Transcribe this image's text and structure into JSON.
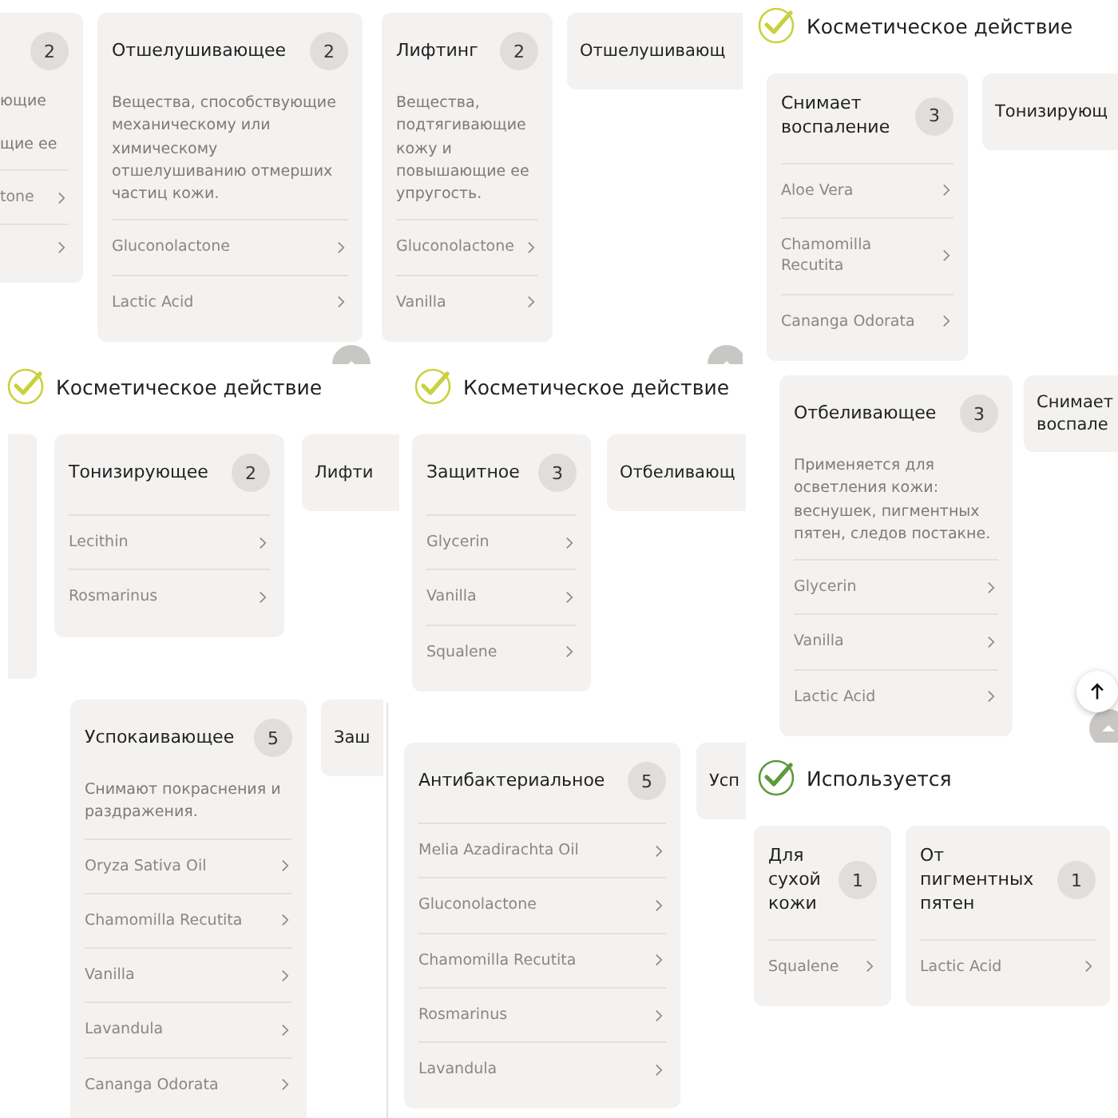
{
  "fragments": [
    {
      "cards": [
        {
          "kind": "partial-left",
          "badge": "2",
          "description_fragments": [
            "ющие",
            "щие ее"
          ],
          "items": [
            {
              "kind": "link",
              "name": "tone"
            },
            {
              "kind": "cut"
            }
          ]
        },
        {
          "kind": "full",
          "title": "Отшелушивающее",
          "badge": "2",
          "description": "Вещества, способствующие механическому или химическому отшелушиванию отмерших частиц кожи.",
          "items": [
            {
              "name": "Gluconolactone"
            },
            {
              "name": "Lactic Acid"
            }
          ]
        }
      ],
      "scroll_button": true
    },
    {
      "cards": [
        {
          "kind": "full",
          "title": "Лифтинг",
          "badge": "2",
          "description": "Вещества, подтягивающие кожу и повышающие ее упругость.",
          "items": [
            {
              "name": "Gluconolactone"
            },
            {
              "name": "Vanilla"
            }
          ]
        },
        {
          "kind": "partial-right",
          "title": "Отшелушивающ"
        }
      ],
      "scroll_button": true
    },
    {
      "heading": {
        "text": "Косметическое действие",
        "color": "#c9d13c"
      },
      "cards": [
        {
          "kind": "full",
          "title": "Снимает воспаление",
          "badge": "3",
          "items": [
            {
              "name": "Aloe Vera"
            },
            {
              "name": "Chamomilla Recutita"
            },
            {
              "name": "Cananga Odorata"
            }
          ]
        },
        {
          "kind": "partial-right",
          "title": "Тонизирующ"
        }
      ]
    },
    {
      "heading": {
        "text": "Косметическое действие",
        "color": "#c9d13c"
      },
      "cards": [
        {
          "kind": "edge"
        },
        {
          "kind": "full",
          "title": "Тонизирующее",
          "badge": "2",
          "items": [
            {
              "name": "Lecithin"
            },
            {
              "name": "Rosmarinus"
            }
          ]
        },
        {
          "kind": "partial-right",
          "title": "Лифти"
        }
      ]
    },
    {
      "heading": {
        "text": "Косметическое действие",
        "color": "#c9d13c"
      },
      "cards": [
        {
          "kind": "full",
          "title": "Защитное",
          "badge": "3",
          "items": [
            {
              "name": "Glycerin"
            },
            {
              "name": "Vanilla"
            },
            {
              "name": "Squalene"
            }
          ]
        },
        {
          "kind": "partial-right",
          "title": "Отбеливающ"
        }
      ]
    },
    {
      "cards": [
        {
          "kind": "full",
          "title": "Отбеливающее",
          "badge": "3",
          "description": "Применяется для осветления кожи: веснушек, пигментных пятен, следов постакне.",
          "items": [
            {
              "name": "Glycerin"
            },
            {
              "name": "Vanilla"
            },
            {
              "name": "Lactic Acid"
            }
          ]
        },
        {
          "kind": "partial-right",
          "title": "Снимает воспале"
        }
      ],
      "back_to_top": true,
      "scroll_button": true
    },
    {
      "cards": [
        {
          "kind": "full",
          "title": "Успокаивающее",
          "badge": "5",
          "description": "Снимают покраснения и раздражения.",
          "items": [
            {
              "name": "Oryza Sativa Oil"
            },
            {
              "name": "Chamomilla Recutita"
            },
            {
              "name": "Vanilla"
            },
            {
              "name": "Lavandula"
            },
            {
              "name": "Cananga Odorata"
            }
          ]
        },
        {
          "kind": "partial-right",
          "title": "Заш"
        }
      ]
    },
    {
      "cards": [
        {
          "kind": "full",
          "title": "Антибактериальное",
          "badge": "5",
          "items": [
            {
              "name": "Melia Azadirachta Oil"
            },
            {
              "name": "Gluconolactone"
            },
            {
              "name": "Chamomilla Recutita"
            },
            {
              "name": "Rosmarinus"
            },
            {
              "name": "Lavandula"
            }
          ]
        },
        {
          "kind": "partial-right",
          "title": "Усп"
        }
      ]
    },
    {
      "heading": {
        "text": "Используется",
        "color": "#5c9a3a"
      },
      "cards": [
        {
          "kind": "full",
          "title": "Для сухой кожи",
          "badge": "1",
          "items": [
            {
              "name": "Squalene"
            }
          ]
        },
        {
          "kind": "full",
          "title": "От пигментных пятен",
          "badge": "1",
          "items": [
            {
              "name": "Lactic Acid"
            }
          ]
        }
      ]
    }
  ]
}
